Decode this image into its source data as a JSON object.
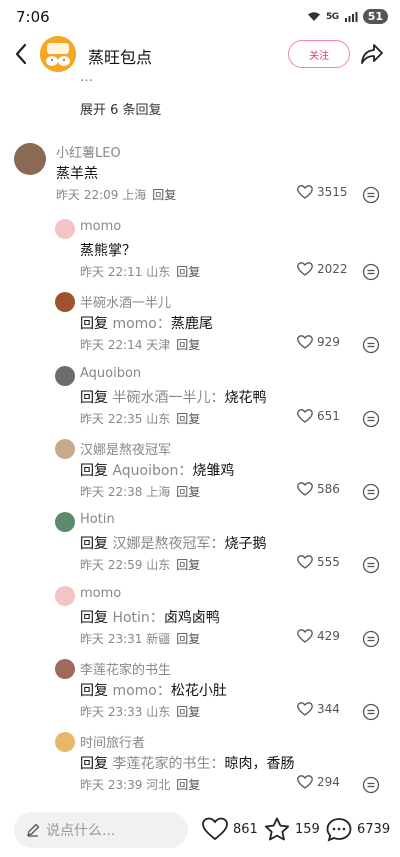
{
  "status_bar": {
    "time": "7:06",
    "network": "5G",
    "battery": "51"
  },
  "header": {
    "title": "蒸旺包点",
    "follow_label": "关注",
    "avatar_text": "蒸旺包点"
  },
  "thread": {
    "cut_text": "…",
    "expand_label": "展开 6 条回复",
    "reply_label": "回复",
    "main": {
      "user": "小红薯LEO",
      "text": "蒸羊羔",
      "time": "昨天 22:09 上海",
      "likes": "3515",
      "avatar_color": "#8a6a55"
    },
    "replies": [
      {
        "user": "momo",
        "prefix": "",
        "target": "",
        "text": "蒸熊掌？",
        "time": "昨天 22:11 山东",
        "likes": "2022",
        "avatar_color": "#f2c4c4"
      },
      {
        "user": "半碗水酒一半儿",
        "prefix": "回复",
        "target": "momo：",
        "text": "蒸鹿尾",
        "time": "昨天 22:14 天津",
        "likes": "929",
        "avatar_color": "#a0522d"
      },
      {
        "user": "Aquoibon",
        "prefix": "回复",
        "target": "半碗水酒一半儿：",
        "text": "烧花鸭",
        "time": "昨天 22:35 山东",
        "likes": "651",
        "avatar_color": "#6b6b6b"
      },
      {
        "user": "汉娜是熬夜冠军",
        "prefix": "回复",
        "target": "Aquoibon：",
        "text": "烧雏鸡",
        "time": "昨天 22:38 上海",
        "likes": "586",
        "avatar_color": "#c9a98a"
      },
      {
        "user": "Hotin",
        "prefix": "回复",
        "target": "汉娜是熬夜冠军：",
        "text": "烧子鹅",
        "time": "昨天 22:59 山东",
        "likes": "555",
        "avatar_color": "#5f8a6a"
      },
      {
        "user": "momo",
        "prefix": "回复",
        "target": "Hotin：",
        "text": "卤鸡卤鸭",
        "time": "昨天 23:31 新疆",
        "likes": "429",
        "avatar_color": "#f2c4c4"
      },
      {
        "user": "李莲花家的书生",
        "prefix": "回复",
        "target": "momo：",
        "text": "松花小肚",
        "time": "昨天 23:33 山东",
        "likes": "344",
        "avatar_color": "#9b6b5b"
      },
      {
        "user": "时间旅行者",
        "prefix": "回复",
        "target": "李莲花家的书生：",
        "text": "晾肉，香肠",
        "time": "昨天 23:39 河北",
        "likes": "294",
        "avatar_color": "#e8b86a"
      }
    ]
  },
  "bottom": {
    "input_placeholder": "说点什么...",
    "likes": "861",
    "stars": "159",
    "comments": "6739"
  },
  "icons": {
    "back": "chevron-left-icon",
    "share": "share-arrow-icon",
    "like": "heart-icon",
    "more": "more-dots-icon",
    "edit": "pencil-icon",
    "star": "star-icon",
    "comment": "comment-bubble-icon"
  }
}
